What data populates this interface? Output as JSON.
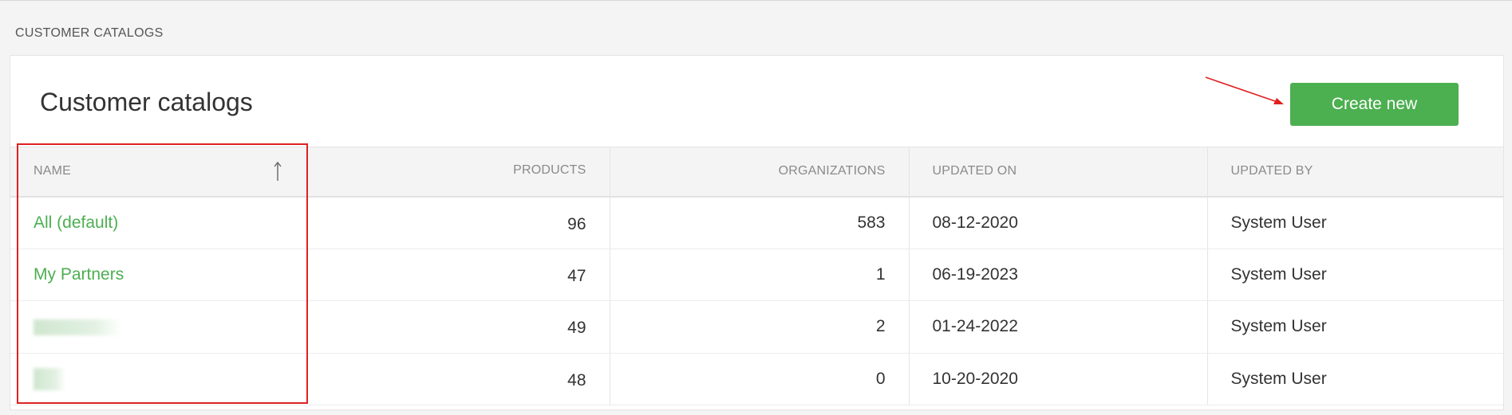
{
  "page": {
    "label": "CUSTOMER CATALOGS"
  },
  "card": {
    "title": "Customer catalogs",
    "create_label": "Create new"
  },
  "table": {
    "columns": [
      "NAME",
      "PRODUCTS",
      "ORGANIZATIONS",
      "UPDATED ON",
      "UPDATED BY"
    ],
    "rows": [
      {
        "name": "All (default)",
        "products": "96",
        "organizations": "583",
        "updated_on": "08-12-2020",
        "updated_by": "System User"
      },
      {
        "name": "My Partners",
        "products": "47",
        "organizations": "1",
        "updated_on": "06-19-2023",
        "updated_by": "System User"
      },
      {
        "name": "",
        "products": "49",
        "organizations": "2",
        "updated_on": "01-24-2022",
        "updated_by": "System User"
      },
      {
        "name": "",
        "products": "48",
        "organizations": "0",
        "updated_on": "10-20-2020",
        "updated_by": "System User"
      }
    ]
  },
  "icons": {
    "sort": "arrow-up-icon"
  },
  "colors": {
    "accent": "#4caf50",
    "annotation": "#e02020"
  }
}
